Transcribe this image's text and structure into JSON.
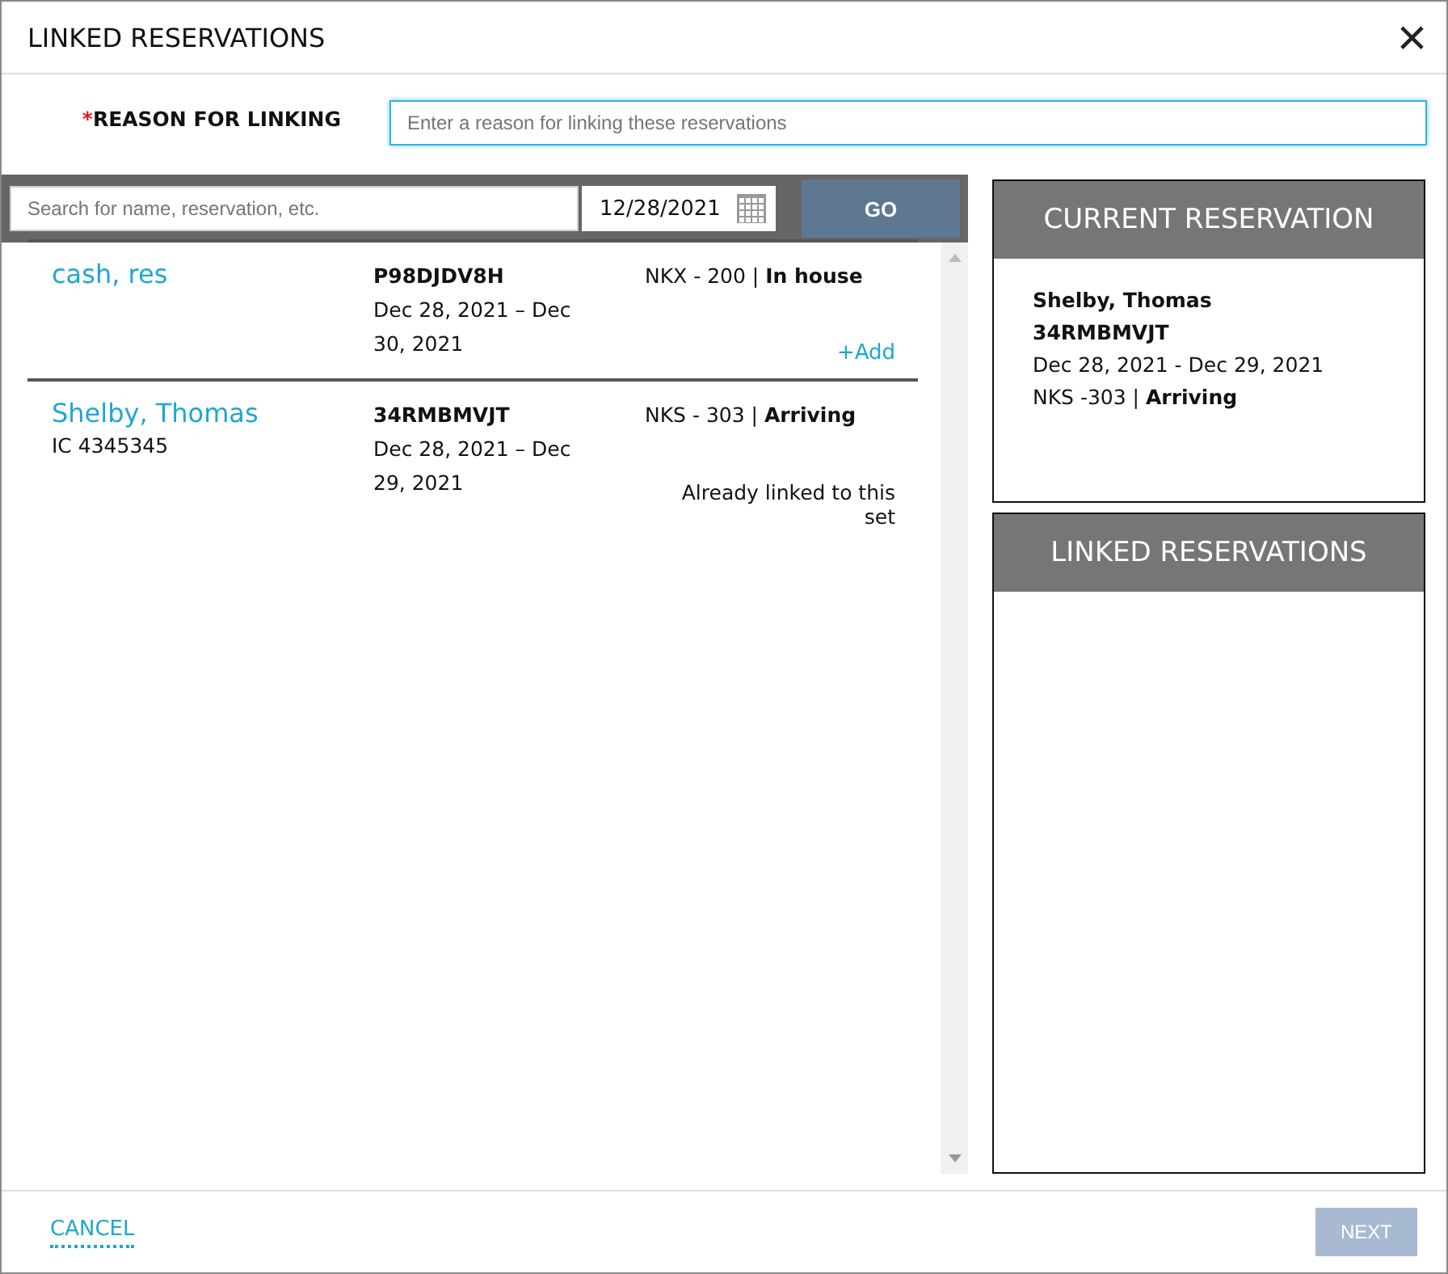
{
  "window": {
    "title": "LINKED RESERVATIONS",
    "close": "×"
  },
  "reason": {
    "required_mark": "*",
    "label": "REASON FOR LINKING",
    "placeholder": "Enter a reason for linking these reservations"
  },
  "search": {
    "placeholder": "Search for name, reservation, etc.",
    "date": "12/28/2021",
    "button": "GO"
  },
  "results": [
    {
      "name": "cash, res",
      "code": "P98DJDV8H",
      "dates": "Dec 28, 2021 – Dec 30, 2021",
      "location": "NKX - 200 | **In house**",
      "action": {
        "kind": "link",
        "text": "+Add"
      }
    },
    {
      "name": "Shelby, Thomas",
      "id": "IC 4345345",
      "code": "34RMBMVJT",
      "dates": "Dec 28, 2021 – Dec 29, 2021",
      "location": "NKS - 303 | **Arriving**",
      "action": {
        "kind": "note",
        "text": "Already linked to this set"
      }
    }
  ],
  "current": {
    "title": "CURRENT RESERVATION",
    "name": "Shelby, Thomas",
    "code": "34RMBMVJT",
    "dates": "Dec 28, 2021 - Dec 29, 2021",
    "location": "NKS -303 | **Arriving**"
  },
  "linked": {
    "title": "LINKED RESERVATIONS"
  },
  "footer": {
    "cancel": "CANCEL",
    "next": {
      "label": "NEXT",
      "disabled": true
    }
  }
}
